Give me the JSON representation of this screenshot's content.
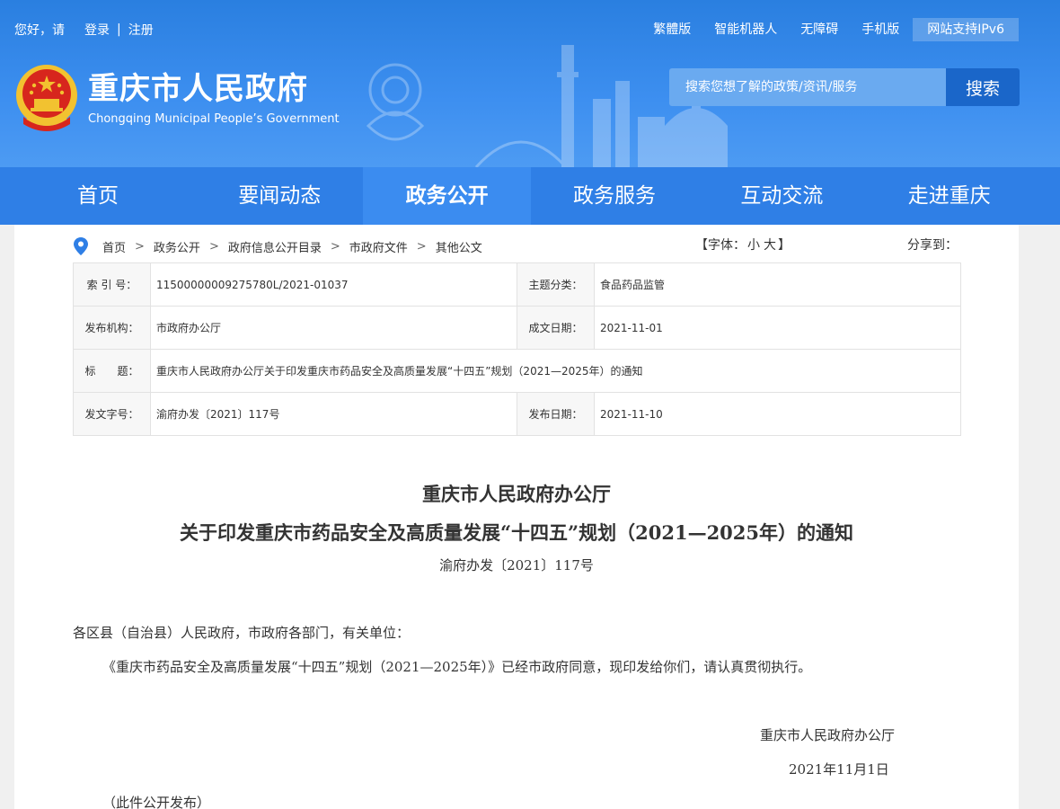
{
  "topbar": {
    "greeting": "您好，请",
    "login": "登录",
    "divider": "|",
    "register": "注册",
    "links": [
      "繁體版",
      "智能机器人",
      "无障碍",
      "手机版"
    ],
    "ipv6": "网站支持IPv6"
  },
  "logo": {
    "cn": "重庆市人民政府",
    "en": "Chongqing Municipal People’s Government"
  },
  "search": {
    "placeholder": "搜索您想了解的政策/资讯/服务",
    "button": "搜索"
  },
  "nav": {
    "items": [
      "首页",
      "要闻动态",
      "政务公开",
      "政务服务",
      "互动交流",
      "走进重庆"
    ],
    "active_index": 2
  },
  "breadcrumb": {
    "items": [
      "首页",
      "政务公开",
      "政府信息公开目录",
      "市政府文件",
      "其他公文"
    ],
    "sep": ">"
  },
  "font_ctrl": {
    "prefix": "【字体：",
    "small": "小",
    "large": "大",
    "suffix": "】"
  },
  "share": "分享到：",
  "meta": {
    "index_label": "索 引 号：",
    "index_value": "11500000009275780L/2021-01037",
    "topic_label": "主题分类：",
    "topic_value": "食品药品监管",
    "issuer_label": "发布机构：",
    "issuer_value": "市政府办公厅",
    "made_label": "成文日期：",
    "made_value": "2021-11-01",
    "title_label": "标　　题：",
    "title_value": "重庆市人民政府办公厅关于印发重庆市药品安全及高质量发展“十四五”规划（2021—2025年）的通知",
    "docno_label": "发文字号：",
    "docno_value": "渝府办发〔2021〕117号",
    "pub_label": "发布日期：",
    "pub_value": "2021-11-10"
  },
  "doc": {
    "title1": "重庆市人民政府办公厅",
    "title2": "关于印发重庆市药品安全及高质量发展“十四五”规划（2021—2025年）的通知",
    "number": "渝府办发〔2021〕117号",
    "addressee": "各区县（自治县）人民政府，市政府各部门，有关单位：",
    "body": "《重庆市药品安全及高质量发展“十四五”规划（2021—2025年）》已经市政府同意，现印发给你们，请认真贯彻执行。",
    "signer": "重庆市人民政府办公厅",
    "date": "2021年11月1日",
    "note": "（此件公开发布）"
  },
  "colors": {
    "header_blue": "#2a7fe0",
    "nav_blue": "#2f7fe6",
    "search_btn": "#1a66c9",
    "emblem_red": "#d7261d",
    "emblem_gold": "#f2c230"
  }
}
